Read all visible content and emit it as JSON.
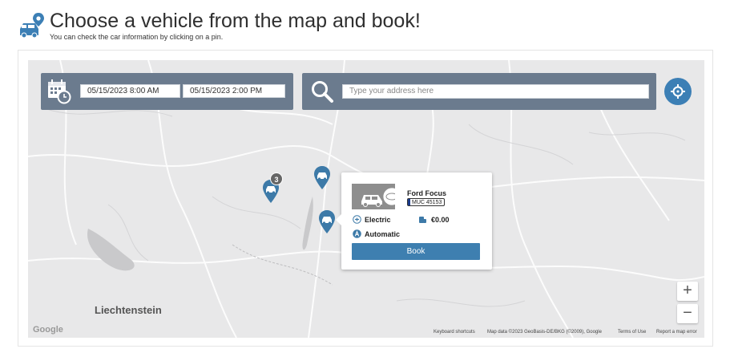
{
  "header": {
    "title": "Choose a vehicle from the map and book!",
    "subtitle": "You can check the car information by clicking on a pin."
  },
  "filters": {
    "date_from": "05/15/2023 8:00 AM",
    "date_to": "05/15/2023 2:00 PM",
    "search_placeholder": "Type your address here"
  },
  "map": {
    "cluster_count": "3",
    "place_label": "Liechtenstein",
    "google_logo": "Google",
    "attribution": {
      "keyboard": "Keyboard shortcuts",
      "data": "Map data ©2023 GeoBasis-DE/BKG (©2009), Google",
      "terms": "Terms of Use",
      "report": "Report a map error"
    },
    "zoom_in": "+",
    "zoom_out": "−"
  },
  "popup": {
    "car_name": "Ford Focus",
    "plate": "MUC 45153",
    "fuel": "Electric",
    "price": "€0.00",
    "transmission": "Automatic",
    "book_label": "Book"
  },
  "colors": {
    "panel": "#6b7b8e",
    "accent": "#3c7fb5",
    "pin": "#3d7aa8"
  }
}
